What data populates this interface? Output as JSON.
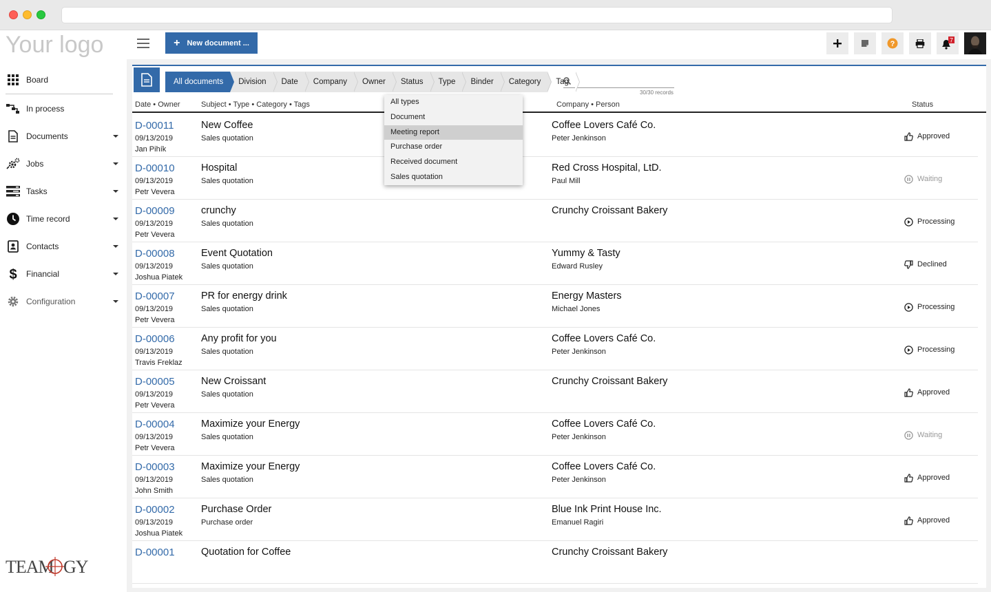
{
  "app": {
    "logo_text": "Your logo",
    "brand_text": "TEAMOGY"
  },
  "sidebar": {
    "items": [
      {
        "label": "Board",
        "icon": "grid-icon",
        "has_arrow": false
      },
      {
        "label": "In process",
        "icon": "process-icon",
        "has_arrow": false
      },
      {
        "label": "Documents",
        "icon": "document-icon",
        "has_arrow": true
      },
      {
        "label": "Jobs",
        "icon": "jobs-gear-icon",
        "has_arrow": true
      },
      {
        "label": "Tasks",
        "icon": "tasks-icon",
        "has_arrow": true
      },
      {
        "label": "Time record",
        "icon": "clock-icon",
        "has_arrow": true
      },
      {
        "label": "Contacts",
        "icon": "contacts-icon",
        "has_arrow": true
      },
      {
        "label": "Financial",
        "icon": "dollar-icon",
        "has_arrow": true
      },
      {
        "label": "Configuration",
        "icon": "gear-icon",
        "has_arrow": true
      }
    ]
  },
  "toolbar": {
    "new_document_label": "New document ...",
    "notification_count": "7",
    "accent": "#336aa9",
    "help_color": "#f0982a"
  },
  "filters": [
    "All documents",
    "Division",
    "Date",
    "Company",
    "Owner",
    "Status",
    "Type",
    "Binder",
    "Category",
    "Tag"
  ],
  "search": {
    "placeholder": "",
    "records": "30/30 records"
  },
  "columns": {
    "date_owner": "Date • Owner",
    "subject": "Subject • Type • Category • Tags",
    "company_person": "Company • Person",
    "status": "Status"
  },
  "type_dropdown": {
    "options": [
      "All types",
      "Document",
      "Meeting report",
      "Purchase order",
      "Received document",
      "Sales quotation"
    ],
    "highlighted": "Meeting report"
  },
  "rows": [
    {
      "id": "D-00011",
      "date": "09/13/2019",
      "owner": "Jan Pihík",
      "subject": "New Coffee",
      "type": "Sales quotation",
      "company": "Coffee Lovers Café Co.",
      "person": "Peter Jenkinson",
      "status": "Approved",
      "status_kind": "approved"
    },
    {
      "id": "D-00010",
      "date": "09/13/2019",
      "owner": "Petr Vevera",
      "subject": "Hospital",
      "type": "Sales quotation",
      "company": "Red Cross Hospital, LtD.",
      "person": "Paul Mill",
      "status": "Waiting",
      "status_kind": "waiting"
    },
    {
      "id": "D-00009",
      "date": "09/13/2019",
      "owner": "Petr Vevera",
      "subject": "crunchy",
      "type": "Sales quotation",
      "company": "Crunchy Croissant Bakery",
      "person": "",
      "status": "Processing",
      "status_kind": "processing"
    },
    {
      "id": "D-00008",
      "date": "09/13/2019",
      "owner": "Joshua Piatek",
      "subject": "Event Quotation",
      "type": "Sales quotation",
      "company": "Yummy & Tasty",
      "person": "Edward Rusley",
      "status": "Declined",
      "status_kind": "declined"
    },
    {
      "id": "D-00007",
      "date": "09/13/2019",
      "owner": "Petr Vevera",
      "subject": "PR for energy drink",
      "type": "Sales quotation",
      "company": "Energy Masters",
      "person": "Michael Jones",
      "status": "Processing",
      "status_kind": "processing"
    },
    {
      "id": "D-00006",
      "date": "09/13/2019",
      "owner": "Travis Freklaz",
      "subject": "Any profit for you",
      "type": "Sales quotation",
      "company": "Coffee Lovers Café Co.",
      "person": "Peter Jenkinson",
      "status": "Processing",
      "status_kind": "processing"
    },
    {
      "id": "D-00005",
      "date": "09/13/2019",
      "owner": "Petr Vevera",
      "subject": "New Croissant",
      "type": "Sales quotation",
      "company": "Crunchy Croissant Bakery",
      "person": "",
      "status": "Approved",
      "status_kind": "approved"
    },
    {
      "id": "D-00004",
      "date": "09/13/2019",
      "owner": "Petr Vevera",
      "subject": "Maximize your Energy",
      "type": "Sales quotation",
      "company": "Coffee Lovers Café Co.",
      "person": "Peter Jenkinson",
      "status": "Waiting",
      "status_kind": "waiting"
    },
    {
      "id": "D-00003",
      "date": "09/13/2019",
      "owner": "John Smith",
      "subject": "Maximize your Energy",
      "type": "Sales quotation",
      "company": "Coffee Lovers Café Co.",
      "person": "Peter Jenkinson",
      "status": "Approved",
      "status_kind": "approved"
    },
    {
      "id": "D-00002",
      "date": "09/13/2019",
      "owner": "Joshua Piatek",
      "subject": "Purchase Order",
      "type": "Purchase order",
      "company": "Blue Ink Print House Inc.",
      "person": "Emanuel Ragiri",
      "status": "Approved",
      "status_kind": "approved"
    },
    {
      "id": "D-00001",
      "date": "",
      "owner": "",
      "subject": "Quotation for Coffee",
      "type": "",
      "company": "Crunchy Croissant Bakery",
      "person": "",
      "status": "",
      "status_kind": ""
    }
  ]
}
